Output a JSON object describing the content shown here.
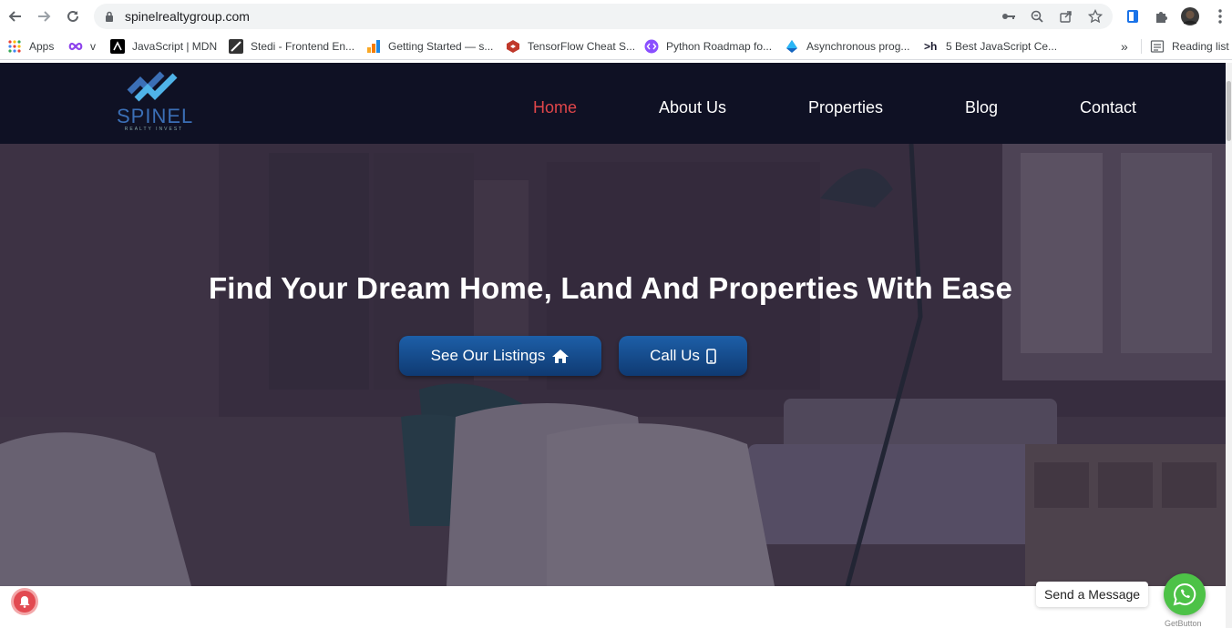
{
  "browser": {
    "url": "spinelrealtygroup.com",
    "bookmarks": [
      {
        "label": "Apps",
        "icon": "apps-grid-icon"
      },
      {
        "label": "v",
        "icon": "infinity-icon"
      },
      {
        "label": "JavaScript | MDN",
        "icon": "mdn-icon"
      },
      {
        "label": "Stedi - Frontend En...",
        "icon": "stedi-icon"
      },
      {
        "label": "Getting Started — s...",
        "icon": "bars-icon"
      },
      {
        "label": "TensorFlow Cheat S...",
        "icon": "tensorflow-icon"
      },
      {
        "label": "Python Roadmap fo...",
        "icon": "roadmap-icon"
      },
      {
        "label": "Asynchronous prog...",
        "icon": "async-icon"
      },
      {
        "label": "5 Best JavaScript Ce...",
        "icon": "hashnode-icon"
      }
    ],
    "overflow_label": "»",
    "reading_list_label": "Reading list"
  },
  "site": {
    "logo_text": "SPINEL",
    "logo_subtext": "REALTY INVEST",
    "nav": [
      {
        "label": "Home",
        "active": true
      },
      {
        "label": "About Us",
        "active": false
      },
      {
        "label": "Properties",
        "active": false
      },
      {
        "label": "Blog",
        "active": false
      },
      {
        "label": "Contact",
        "active": false
      }
    ],
    "hero": {
      "title": "Find Your Dream Home, Land And Properties With Ease",
      "primary_cta": "See Our Listings",
      "secondary_cta": "Call Us"
    },
    "chat": {
      "label": "Send a Message",
      "powered_by": "GetButton"
    }
  },
  "colors": {
    "header_bg": "#0f1124",
    "nav_active": "#e0464a",
    "cta_bg": "#1d5fa8",
    "whatsapp": "#4dc247"
  }
}
